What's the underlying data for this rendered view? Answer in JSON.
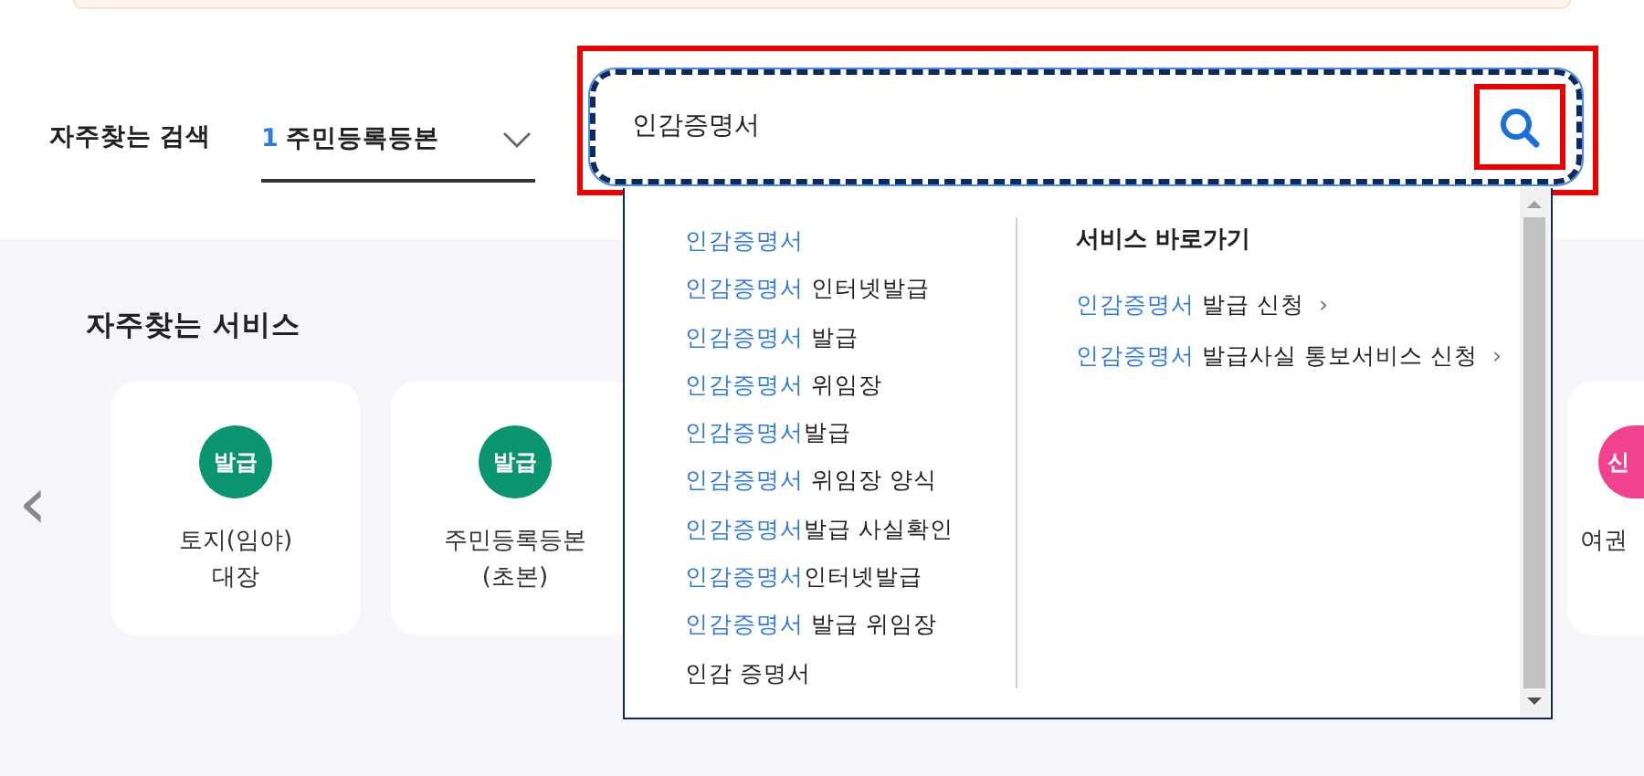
{
  "search_bar": {
    "label": "자주찾는 검색",
    "select": {
      "rank": "1",
      "value": "주민등록등본"
    },
    "query": "인감증명서"
  },
  "autocomplete": {
    "suggestions": [
      {
        "match": "인감증명서"
      },
      {
        "match": "인감증명서",
        "rest": " 인터넷발급"
      },
      {
        "match": "인감증명서",
        "rest": " 발급"
      },
      {
        "match": "인감증명서",
        "rest": " 위임장"
      },
      {
        "match": "인감증명서",
        "rest": "발급"
      },
      {
        "match": "인감증명서",
        "rest": " 위임장 양식"
      },
      {
        "match": "인감증명서",
        "rest": "발급 사실확인"
      },
      {
        "match": "인감증명서",
        "rest": "인터넷발급"
      },
      {
        "match": "인감증명서",
        "rest": " 발급 위임장"
      },
      {
        "rest": "인감 증명서"
      }
    ],
    "shortcuts_title": "서비스 바로가기",
    "shortcuts": [
      {
        "match": "인감증명서",
        "rest": " 발급 신청",
        "arrow": "›"
      },
      {
        "match": "인감증명서",
        "rest": " 발급사실 통보서비스 신청",
        "arrow": "›"
      }
    ]
  },
  "frequent_services": {
    "title": "자주찾는 서비스",
    "prev": "‹",
    "cards": [
      {
        "badge": "발급",
        "color": "#0b9470",
        "title": "토지(임야)\n대장"
      },
      {
        "badge": "발급",
        "color": "#0b9470",
        "title": "주민등록등본\n(초본)"
      },
      {
        "badge": "신",
        "color": "#f0428f",
        "title": "여권",
        "partial": true
      }
    ]
  }
}
